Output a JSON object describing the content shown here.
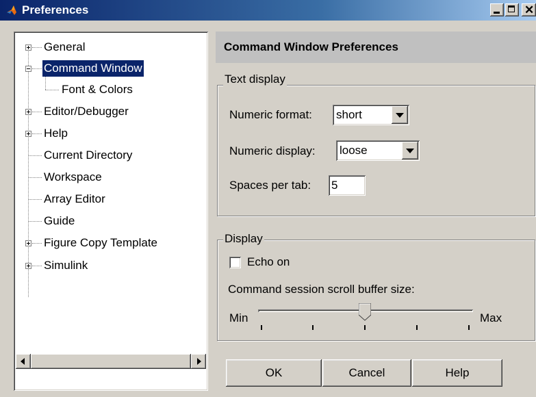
{
  "window": {
    "title": "Preferences",
    "controls": {
      "minimize": "minimize",
      "maximize": "maximize",
      "close": "✕"
    }
  },
  "tree": {
    "items": [
      {
        "label": "General",
        "expander": "plus"
      },
      {
        "label": "Command Window",
        "expander": "minus",
        "selected": true
      },
      {
        "label": "Font & Colors",
        "child": true
      },
      {
        "label": "Editor/Debugger",
        "expander": "plus"
      },
      {
        "label": "Help",
        "expander": "plus"
      },
      {
        "label": "Current Directory"
      },
      {
        "label": "Workspace"
      },
      {
        "label": "Array Editor"
      },
      {
        "label": "Guide"
      },
      {
        "label": "Figure Copy Template",
        "expander": "plus"
      },
      {
        "label": "Simulink",
        "expander": "plus"
      }
    ]
  },
  "panel": {
    "title": "Command Window Preferences",
    "text_display": {
      "legend": "Text display",
      "numeric_format_label": "Numeric format:",
      "numeric_format_value": "short",
      "numeric_display_label": "Numeric display:",
      "numeric_display_value": "loose",
      "spaces_per_tab_label": "Spaces per tab:",
      "spaces_per_tab_value": "5"
    },
    "display": {
      "legend": "Display",
      "echo_label": "Echo on",
      "echo_checked": false,
      "scroll_buffer_label": "Command session scroll buffer size:",
      "min_label": "Min",
      "max_label": "Max",
      "scroll_buffer_level": 0.5
    }
  },
  "buttons": {
    "ok": "OK",
    "cancel": "Cancel",
    "help": "Help"
  },
  "colors": {
    "titlebar": "#0a246a",
    "selection": "#0a246a",
    "face": "#d4d0c8",
    "header": "#c0c0c0"
  }
}
